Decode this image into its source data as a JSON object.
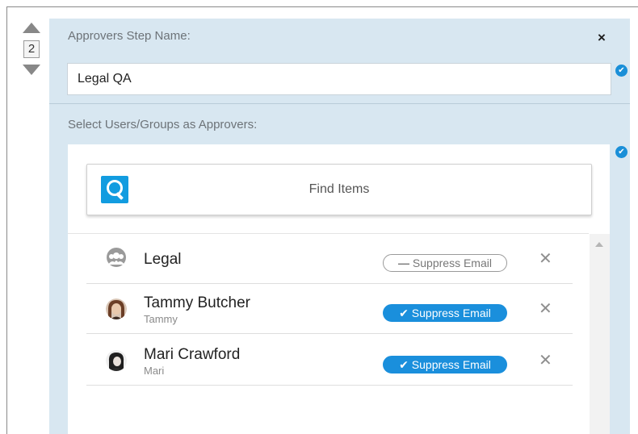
{
  "step": {
    "order_number": "2",
    "name_label": "Approvers Step Name:",
    "name_value": "Legal QA",
    "close_glyph": "×"
  },
  "approvers": {
    "label": "Select Users/Groups as Approvers:",
    "find_label": "Find Items",
    "items": [
      {
        "name": "Legal",
        "sub": "",
        "type": "group",
        "suppress_label": "Suppress Email",
        "suppress_on": false
      },
      {
        "name": "Tammy Butcher",
        "sub": "Tammy",
        "type": "user",
        "suppress_label": "Suppress Email",
        "suppress_on": true
      },
      {
        "name": "Mari Crawford",
        "sub": "Mari",
        "type": "user",
        "suppress_label": "Suppress Email",
        "suppress_on": true
      }
    ],
    "remove_glyph": "✕"
  },
  "icons": {
    "check": "✔",
    "minus": "—"
  },
  "colors": {
    "accent": "#1a8fdc",
    "panel": "#d8e7f1"
  }
}
